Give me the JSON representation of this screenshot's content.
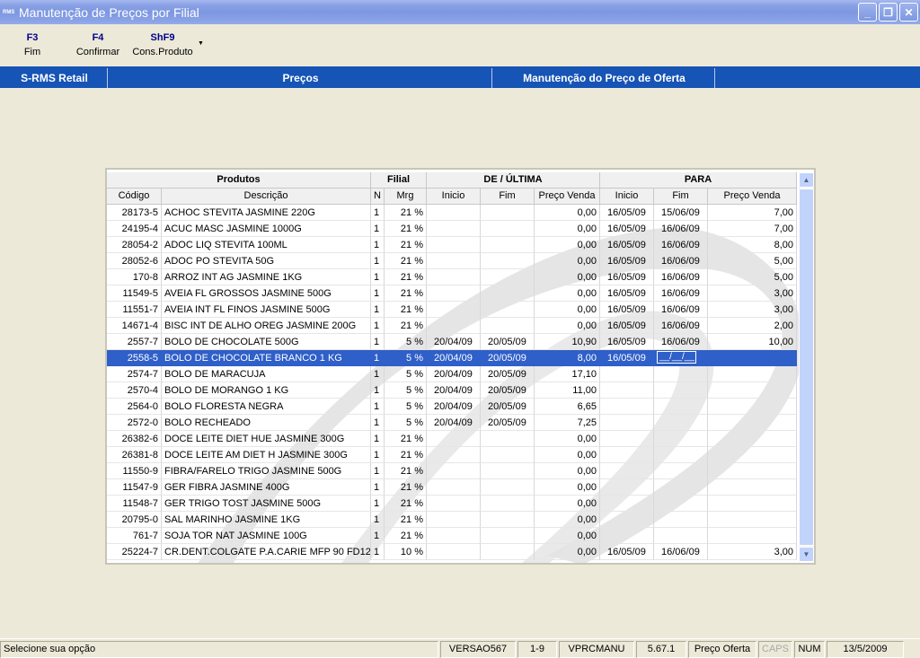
{
  "window": {
    "icon_text": "RMS",
    "title": "Manutenção de Preços por Filial"
  },
  "toolbar": {
    "buttons": [
      {
        "key": "F3",
        "label": "Fim"
      },
      {
        "key": "F4",
        "label": "Confirmar"
      },
      {
        "key": "ShF9",
        "label": "Cons.Produto"
      }
    ]
  },
  "header": {
    "app_name": "S-RMS Retail",
    "module": "Preços",
    "screen": "Manutenção do Preço de Oferta"
  },
  "grid": {
    "groups": {
      "produtos": "Produtos",
      "filial": "Filial",
      "de_ultima": "DE / ÚLTIMA",
      "para": "PARA"
    },
    "columns": {
      "codigo": "Código",
      "descricao": "Descrição",
      "n": "N",
      "mrg": "Mrg",
      "de_inicio": "Inicio",
      "de_fim": "Fim",
      "de_preco": "Preço Venda",
      "para_inicio": "Inicio",
      "para_fim": "Fim",
      "para_preco": "Preço Venda"
    },
    "selected_row": 9,
    "edit_mask": "__/__/__",
    "rows": [
      {
        "codigo": "28173-5",
        "descricao": "ACHOC STEVITA JASMINE 220G",
        "n": "1",
        "mrg": "21 %",
        "de_inicio": "",
        "de_fim": "",
        "de_preco": "0,00",
        "para_inicio": "16/05/09",
        "para_fim": "15/06/09",
        "para_preco": "7,00"
      },
      {
        "codigo": "24195-4",
        "descricao": "ACUC MASC JASMINE 1000G",
        "n": "1",
        "mrg": "21 %",
        "de_inicio": "",
        "de_fim": "",
        "de_preco": "0,00",
        "para_inicio": "16/05/09",
        "para_fim": "16/06/09",
        "para_preco": "7,00"
      },
      {
        "codigo": "28054-2",
        "descricao": "ADOC LIQ STEVITA 100ML",
        "n": "1",
        "mrg": "21 %",
        "de_inicio": "",
        "de_fim": "",
        "de_preco": "0,00",
        "para_inicio": "16/05/09",
        "para_fim": "16/06/09",
        "para_preco": "8,00"
      },
      {
        "codigo": "28052-6",
        "descricao": "ADOC PO STEVITA 50G",
        "n": "1",
        "mrg": "21 %",
        "de_inicio": "",
        "de_fim": "",
        "de_preco": "0,00",
        "para_inicio": "16/05/09",
        "para_fim": "16/06/09",
        "para_preco": "5,00"
      },
      {
        "codigo": "170-8",
        "descricao": "ARROZ INT AG JASMINE 1KG",
        "n": "1",
        "mrg": "21 %",
        "de_inicio": "",
        "de_fim": "",
        "de_preco": "0,00",
        "para_inicio": "16/05/09",
        "para_fim": "16/06/09",
        "para_preco": "5,00"
      },
      {
        "codigo": "11549-5",
        "descricao": "AVEIA FL GROSSOS JASMINE 500G",
        "n": "1",
        "mrg": "21 %",
        "de_inicio": "",
        "de_fim": "",
        "de_preco": "0,00",
        "para_inicio": "16/05/09",
        "para_fim": "16/06/09",
        "para_preco": "3,00"
      },
      {
        "codigo": "11551-7",
        "descricao": "AVEIA INT FL FINOS JASMINE 500G",
        "n": "1",
        "mrg": "21 %",
        "de_inicio": "",
        "de_fim": "",
        "de_preco": "0,00",
        "para_inicio": "16/05/09",
        "para_fim": "16/06/09",
        "para_preco": "3,00"
      },
      {
        "codigo": "14671-4",
        "descricao": "BISC INT DE ALHO OREG JASMINE 200G",
        "n": "1",
        "mrg": "21 %",
        "de_inicio": "",
        "de_fim": "",
        "de_preco": "0,00",
        "para_inicio": "16/05/09",
        "para_fim": "16/06/09",
        "para_preco": "2,00"
      },
      {
        "codigo": "2557-7",
        "descricao": "BOLO DE CHOCOLATE 500G",
        "n": "1",
        "mrg": "5 %",
        "de_inicio": "20/04/09",
        "de_fim": "20/05/09",
        "de_preco": "10,90",
        "para_inicio": "16/05/09",
        "para_fim": "16/06/09",
        "para_preco": "10,00"
      },
      {
        "codigo": "2558-5",
        "descricao": "BOLO DE CHOCOLATE BRANCO 1 KG",
        "n": "1",
        "mrg": "5 %",
        "de_inicio": "20/04/09",
        "de_fim": "20/05/09",
        "de_preco": "8,00",
        "para_inicio": "16/05/09",
        "para_fim": "",
        "para_preco": ""
      },
      {
        "codigo": "2574-7",
        "descricao": "BOLO DE MARACUJA",
        "n": "1",
        "mrg": "5 %",
        "de_inicio": "20/04/09",
        "de_fim": "20/05/09",
        "de_preco": "17,10",
        "para_inicio": "",
        "para_fim": "",
        "para_preco": ""
      },
      {
        "codigo": "2570-4",
        "descricao": "BOLO DE MORANGO 1 KG",
        "n": "1",
        "mrg": "5 %",
        "de_inicio": "20/04/09",
        "de_fim": "20/05/09",
        "de_preco": "11,00",
        "para_inicio": "",
        "para_fim": "",
        "para_preco": ""
      },
      {
        "codigo": "2564-0",
        "descricao": "BOLO FLORESTA NEGRA",
        "n": "1",
        "mrg": "5 %",
        "de_inicio": "20/04/09",
        "de_fim": "20/05/09",
        "de_preco": "6,65",
        "para_inicio": "",
        "para_fim": "",
        "para_preco": ""
      },
      {
        "codigo": "2572-0",
        "descricao": "BOLO RECHEADO",
        "n": "1",
        "mrg": "5 %",
        "de_inicio": "20/04/09",
        "de_fim": "20/05/09",
        "de_preco": "7,25",
        "para_inicio": "",
        "para_fim": "",
        "para_preco": ""
      },
      {
        "codigo": "26382-6",
        "descricao": "DOCE  LEITE DIET HUE JASMINE 300G",
        "n": "1",
        "mrg": "21 %",
        "de_inicio": "",
        "de_fim": "",
        "de_preco": "0,00",
        "para_inicio": "",
        "para_fim": "",
        "para_preco": ""
      },
      {
        "codigo": "26381-8",
        "descricao": "DOCE LEITE AM DIET H JASMINE 300G",
        "n": "1",
        "mrg": "21 %",
        "de_inicio": "",
        "de_fim": "",
        "de_preco": "0,00",
        "para_inicio": "",
        "para_fim": "",
        "para_preco": ""
      },
      {
        "codigo": "11550-9",
        "descricao": "FIBRA/FARELO TRIGO JASMINE 500G",
        "n": "1",
        "mrg": "21 %",
        "de_inicio": "",
        "de_fim": "",
        "de_preco": "0,00",
        "para_inicio": "",
        "para_fim": "",
        "para_preco": ""
      },
      {
        "codigo": "11547-9",
        "descricao": "GER FIBRA JASMINE 400G",
        "n": "1",
        "mrg": "21 %",
        "de_inicio": "",
        "de_fim": "",
        "de_preco": "0,00",
        "para_inicio": "",
        "para_fim": "",
        "para_preco": ""
      },
      {
        "codigo": "11548-7",
        "descricao": "GER TRIGO TOST JASMINE 500G",
        "n": "1",
        "mrg": "21 %",
        "de_inicio": "",
        "de_fim": "",
        "de_preco": "0,00",
        "para_inicio": "",
        "para_fim": "",
        "para_preco": ""
      },
      {
        "codigo": "20795-0",
        "descricao": "SAL MARINHO JASMINE 1KG",
        "n": "1",
        "mrg": "21 %",
        "de_inicio": "",
        "de_fim": "",
        "de_preco": "0,00",
        "para_inicio": "",
        "para_fim": "",
        "para_preco": ""
      },
      {
        "codigo": "761-7",
        "descricao": "SOJA TOR NAT JASMINE 100G",
        "n": "1",
        "mrg": "21 %",
        "de_inicio": "",
        "de_fim": "",
        "de_preco": "0,00",
        "para_inicio": "",
        "para_fim": "",
        "para_preco": ""
      },
      {
        "codigo": "25224-7",
        "descricao": "CR.DENT.COLGATE P.A.CARIE MFP 90 FD12",
        "n": "1",
        "mrg": "10 %",
        "de_inicio": "",
        "de_fim": "",
        "de_preco": "0,00",
        "para_inicio": "16/05/09",
        "para_fim": "16/06/09",
        "para_preco": "3,00"
      }
    ]
  },
  "statusbar": {
    "message": "Selecione sua opção",
    "version": "VERSAO567",
    "page": "1-9",
    "program": "VPRCMANU",
    "build": "5.67.1",
    "mode": "Preço Oferta",
    "caps": "CAPS",
    "num": "NUM",
    "date": "13/5/2009"
  },
  "colors": {
    "header_blue": "#1654B6",
    "selection_blue": "#2F5FC8",
    "title_bar": "#7d97e0",
    "window_bg": "#ECE9D8"
  }
}
